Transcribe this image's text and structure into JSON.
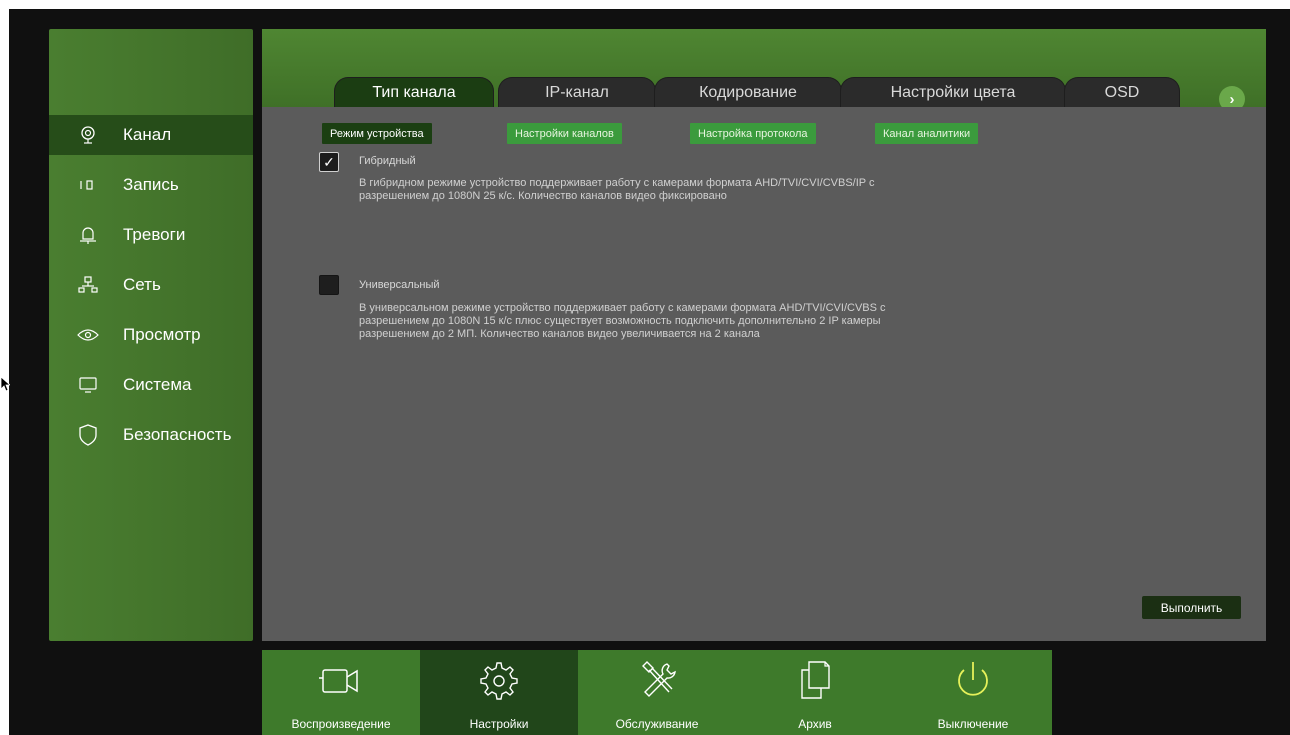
{
  "sidebar": {
    "items": [
      {
        "label": "Канал",
        "icon": "camera-icon",
        "active": true
      },
      {
        "label": "Запись",
        "icon": "record-icon",
        "active": false
      },
      {
        "label": "Тревоги",
        "icon": "bell-icon",
        "active": false
      },
      {
        "label": "Сеть",
        "icon": "network-icon",
        "active": false
      },
      {
        "label": "Просмотр",
        "icon": "eye-icon",
        "active": false
      },
      {
        "label": "Система",
        "icon": "monitor-icon",
        "active": false
      },
      {
        "label": "Безопасность",
        "icon": "shield-icon",
        "active": false
      }
    ]
  },
  "tabs": [
    {
      "label": "Тип канала",
      "active": true
    },
    {
      "label": "IP-канал",
      "active": false
    },
    {
      "label": "Кодирование",
      "active": false
    },
    {
      "label": "Настройки цвета",
      "active": false
    },
    {
      "label": "OSD",
      "active": false
    }
  ],
  "tab_next": "›",
  "subtabs": [
    {
      "label": "Режим устройства",
      "active": true
    },
    {
      "label": "Настройки каналов",
      "active": false
    },
    {
      "label": "Настройка протокола",
      "active": false
    },
    {
      "label": "Канал аналитики",
      "active": false
    }
  ],
  "options": {
    "hybrid": {
      "label": "Гибридный",
      "checked": true,
      "description": "В гибридном режиме устройство поддерживает работу с камерами формата AHD/TVI/CVI/CVBS/IP с\n разрешением  до 1080N  25 к/с. Количество каналов видео фиксировано"
    },
    "universal": {
      "label": "Универсальный",
      "checked": false,
      "description": "В универсальном режиме устройство поддерживает работу с камерами формата AHD/TVI/CVI/CVBS  с\n разрешением до 1080N  15 к/с плюс существует  возможность подключить дополнительно 2 IP камеры\n разрешением до 2 МП. Количество каналов видео увеличивается на 2 канала"
    }
  },
  "apply_label": "Выполнить",
  "checkmark": "✓",
  "bottom_bar": {
    "items": [
      {
        "label": "Воспроизведение",
        "icon": "playback-camera-icon",
        "active": false
      },
      {
        "label": "Настройки",
        "icon": "settings-gear-icon",
        "active": true
      },
      {
        "label": "Обслуживание",
        "icon": "tools-icon",
        "active": false
      },
      {
        "label": "Архив",
        "icon": "archive-icon",
        "active": false
      },
      {
        "label": "Выключение",
        "icon": "power-icon",
        "active": false
      }
    ]
  },
  "colors": {
    "accent_green": "#3b9b3d",
    "active_green": "#1b3d12",
    "power_icon": "#e6f15a"
  }
}
